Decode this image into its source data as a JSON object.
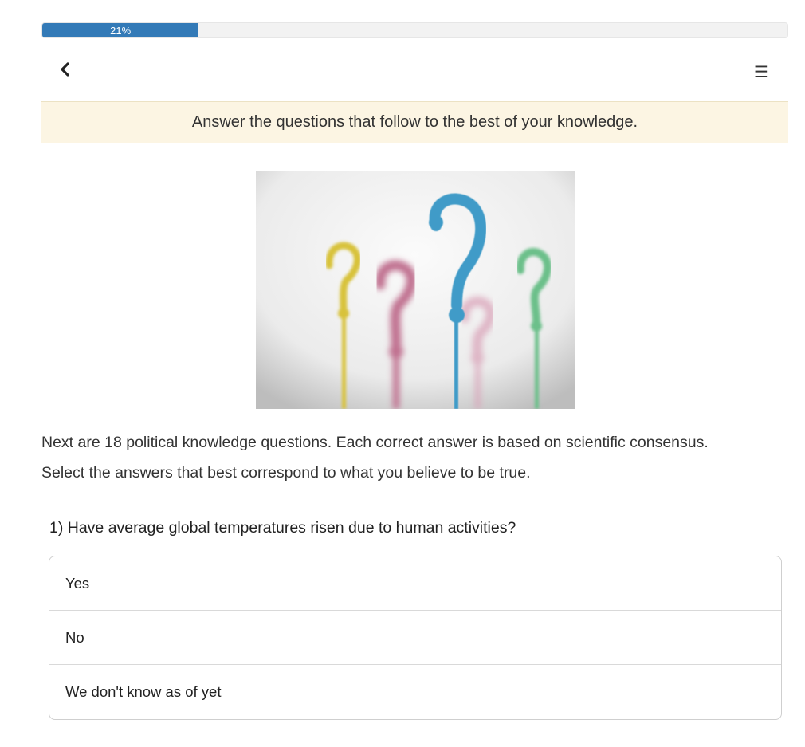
{
  "progress": {
    "value": 0.21,
    "label": "21%"
  },
  "nav": {
    "back_icon": "chevron-left-icon",
    "menu_icon": "hamburger-menu-icon",
    "menu_glyph": "☰"
  },
  "banner": {
    "text": "Answer the questions that follow to the best of your knowledge."
  },
  "hero": {
    "colors": {
      "yellow": "#d8c23a",
      "pink": "#c0708f",
      "blue": "#3f9bc8",
      "green": "#6cc08a",
      "bg": "#f2f2f2"
    }
  },
  "intro": {
    "line1": "Next are 18 political knowledge questions. Each correct answer is based on scientific consensus.",
    "line2": "Select the answers that best correspond to what you believe to be true."
  },
  "question": {
    "title": "1) Have average global temperatures risen due to human activities?",
    "options": [
      {
        "label": "Yes"
      },
      {
        "label": "No"
      },
      {
        "label": "We don't know as of yet"
      }
    ]
  },
  "colors": {
    "accent": "#337ab7",
    "banner_bg": "#fcf5e3"
  }
}
